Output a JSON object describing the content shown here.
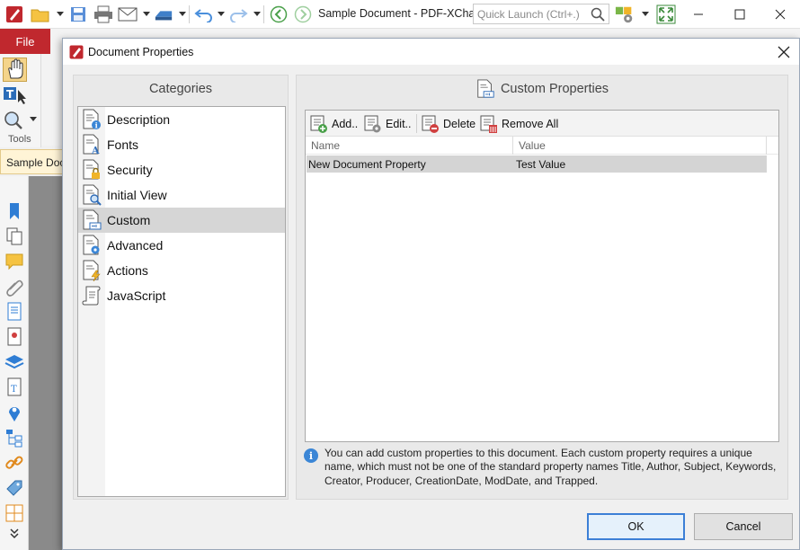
{
  "app": {
    "title": "Sample Document - PDF-XCha..",
    "quick_launch_placeholder": "Quick Launch (Ctrl+.)",
    "file_tab": "File",
    "tools_label": "Tools",
    "doc_tab": "Sample Doc",
    "brand_color": "#c0282e"
  },
  "dialog": {
    "title": "Document Properties",
    "categories": {
      "header": "Categories",
      "items": [
        {
          "label": "Description",
          "icon": "description-icon"
        },
        {
          "label": "Fonts",
          "icon": "fonts-icon"
        },
        {
          "label": "Security",
          "icon": "security-lock-icon"
        },
        {
          "label": "Initial View",
          "icon": "initial-view-icon"
        },
        {
          "label": "Custom",
          "icon": "custom-icon",
          "selected": true
        },
        {
          "label": "Advanced",
          "icon": "advanced-gear-icon"
        },
        {
          "label": "Actions",
          "icon": "actions-lightning-icon"
        },
        {
          "label": "JavaScript",
          "icon": "javascript-scroll-icon"
        }
      ]
    },
    "custom": {
      "header": "Custom Properties",
      "toolbar": {
        "add": "Add..",
        "edit": "Edit..",
        "delete": "Delete",
        "remove_all": "Remove All"
      },
      "columns": [
        "Name",
        "Value"
      ],
      "rows": [
        {
          "name": "New Document Property",
          "value": "Test Value"
        }
      ],
      "info": "You can add custom properties to this document. Each custom property requires a unique name, which must not be one of the standard property names Title, Author, Subject, Keywords, Creator, Producer, CreationDate, ModDate, and Trapped."
    },
    "ok": "OK",
    "cancel": "Cancel"
  }
}
